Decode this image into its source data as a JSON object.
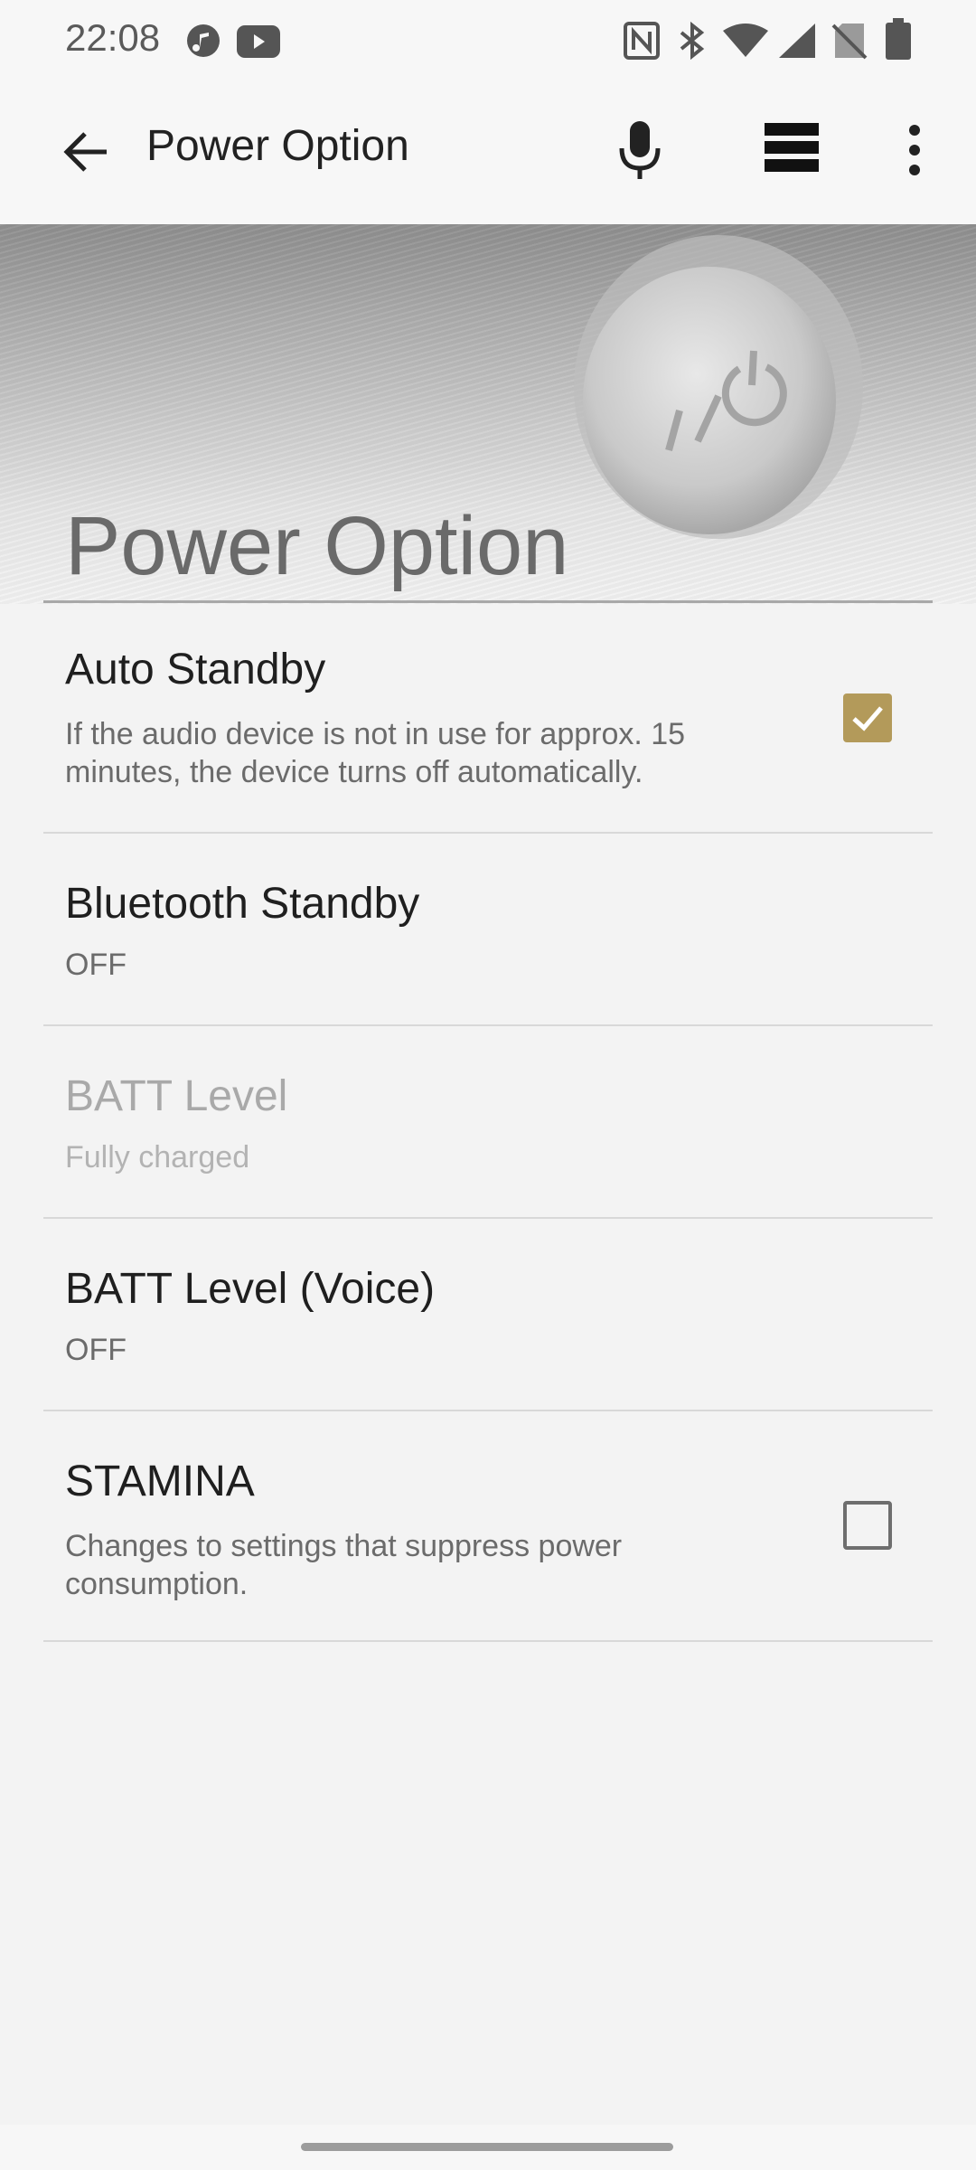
{
  "status_bar": {
    "time": "22:08",
    "left_icons": [
      "music-note-icon",
      "youtube-icon"
    ],
    "right_icons": [
      "nfc-icon",
      "bluetooth-icon",
      "wifi-icon",
      "signal-icon",
      "no-sim-icon",
      "battery-icon"
    ]
  },
  "app_bar": {
    "title": "Power Option",
    "icons": [
      "back-arrow-icon",
      "microphone-icon",
      "grid-icon",
      "more-vert-icon"
    ]
  },
  "hero": {
    "title": "Power Option"
  },
  "settings": [
    {
      "title": "Auto Standby",
      "summary": "If the audio device is not in use for approx. 15 minutes, the device turns off automatically.",
      "checkbox": true,
      "checked": true,
      "enabled": true
    },
    {
      "title": "Bluetooth Standby",
      "summary": "OFF",
      "checkbox": false,
      "enabled": true
    },
    {
      "title": "BATT Level",
      "summary": "Fully charged",
      "checkbox": false,
      "enabled": false
    },
    {
      "title": "BATT Level (Voice)",
      "summary": "OFF",
      "checkbox": false,
      "enabled": true
    },
    {
      "title": "STAMINA",
      "summary": "Changes to settings that suppress power consumption.",
      "checkbox": true,
      "checked": false,
      "enabled": true
    }
  ],
  "colors": {
    "accent": "#b39a5a",
    "background": "#f3f3f3"
  }
}
